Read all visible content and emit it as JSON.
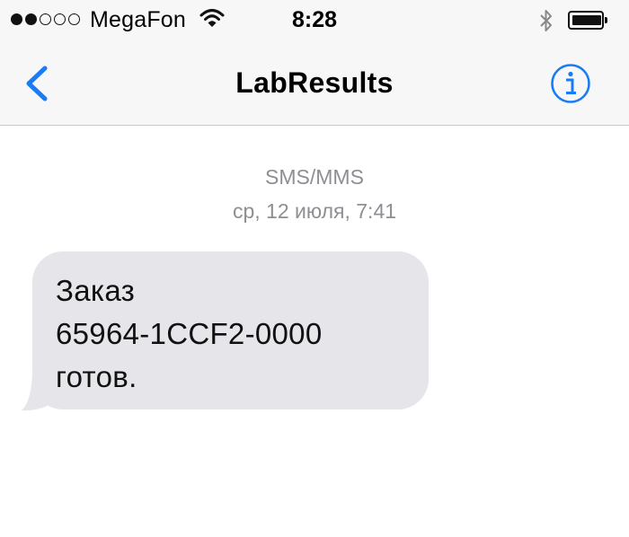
{
  "status_bar": {
    "signal_bars": {
      "filled": 2,
      "total": 5
    },
    "carrier": "MegaFon",
    "time": "8:28",
    "icons": [
      "wifi-icon",
      "bluetooth-icon",
      "battery-icon"
    ]
  },
  "nav": {
    "back_icon": "chevron-left-icon",
    "title": "LabResults",
    "info_icon": "info-icon",
    "accent_color": "#1a7cf5"
  },
  "conversation": {
    "type_label": "SMS/MMS",
    "date_day": "ср, 12 июля,",
    "date_time": "7:41",
    "messages": [
      {
        "direction": "incoming",
        "lines": [
          "Заказ",
          "65964-1CCF2-0000",
          "готов."
        ]
      }
    ]
  },
  "colors": {
    "bar_background": "#f7f7f7",
    "bubble_incoming": "#e5e5ea",
    "meta_text": "#8e8e93"
  }
}
